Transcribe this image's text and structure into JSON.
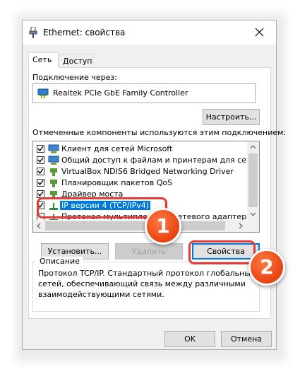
{
  "window": {
    "title": "Ethernet: свойства"
  },
  "tabs": [
    {
      "label": "Сеть",
      "active": true
    },
    {
      "label": "Доступ",
      "active": false
    }
  ],
  "connect_via": {
    "label": "Подключение через:",
    "adapter": "Realtek PCIe GbE Family Controller",
    "configure_button": "Настроить..."
  },
  "components": {
    "label": "Отмеченные компоненты используются этим подключением:",
    "items": [
      {
        "label": "Клиент для сетей Microsoft",
        "checked": true,
        "icon": "network-client-icon"
      },
      {
        "label": "Общий доступ к файлам и принтерам для сетей Mi",
        "checked": true,
        "icon": "file-sharing-icon"
      },
      {
        "label": "VirtualBox NDIS6 Bridged Networking Driver",
        "checked": true,
        "icon": "driver-icon"
      },
      {
        "label": "Планировщик пакетов QoS",
        "checked": true,
        "icon": "qos-icon"
      },
      {
        "label": "Драйвер моста",
        "checked": true,
        "icon": "bridge-icon"
      },
      {
        "label": "IP версии 4 (TCP/IPv4)",
        "checked": true,
        "selected": true,
        "icon": "protocol-icon"
      },
      {
        "label": "Протокол мультиплексора сетевого адаптера (Ма",
        "checked": false,
        "icon": "protocol-icon"
      }
    ]
  },
  "buttons": {
    "install": "Установить...",
    "remove": "Удалить",
    "properties": "Свойства",
    "ok": "OK",
    "cancel": "Отмена"
  },
  "description": {
    "label": "Описание",
    "text_line1": "Протокол TCP/IP. Стандартный протокол глобальных",
    "text_line2": "сетей, обеспечивающий связь между различными",
    "text_line3": "взаимодействующими сетями."
  },
  "callouts": [
    {
      "number": "1"
    },
    {
      "number": "2"
    }
  ],
  "colors": {
    "accent": "#0078d7",
    "callout_red": "#e53935",
    "badge_orange": "#e8420f"
  }
}
